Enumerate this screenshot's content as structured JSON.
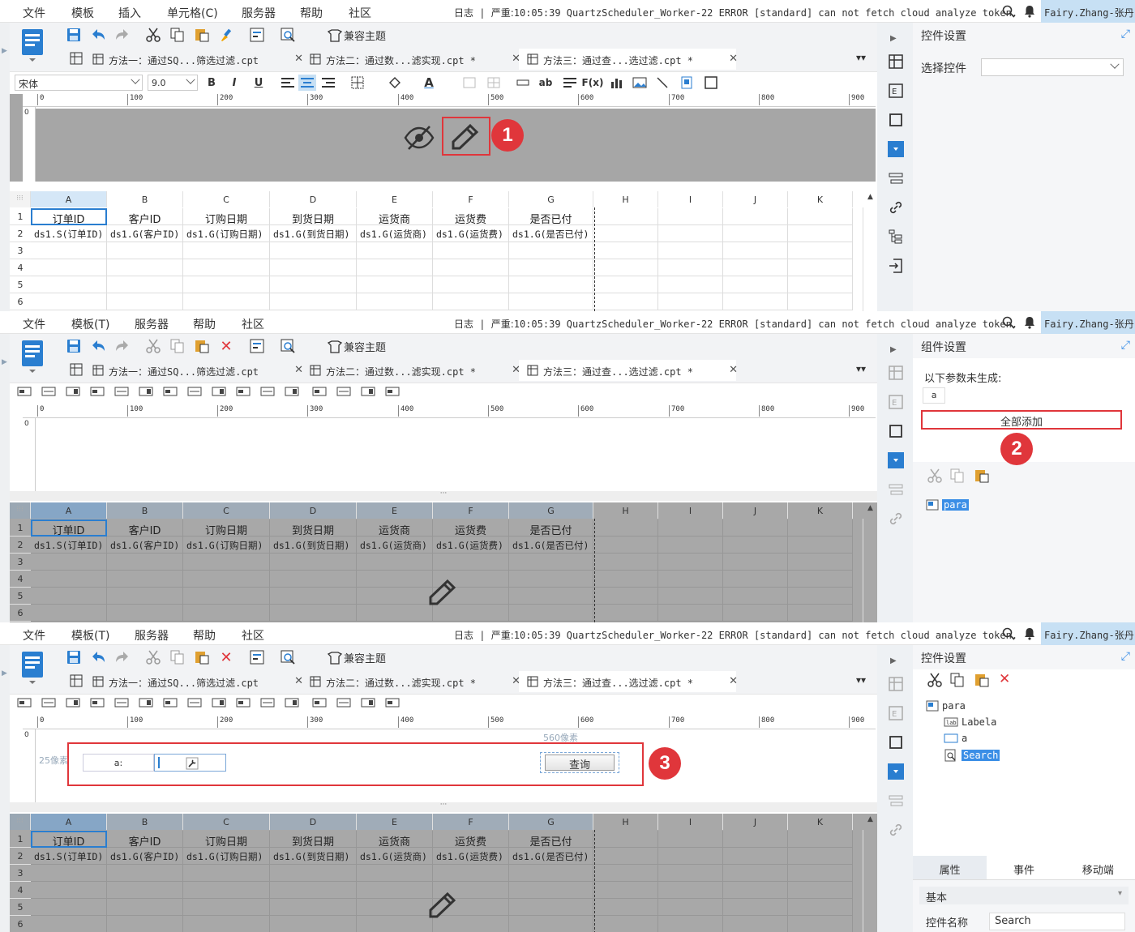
{
  "menus_p1": [
    "文件",
    "模板",
    "插入",
    "单元格(C)",
    "服务器",
    "帮助",
    "社区"
  ],
  "menus_p2": [
    "文件",
    "模板(T)",
    "服务器",
    "帮助",
    "社区"
  ],
  "log": {
    "label": "日志",
    "severity": "严重:",
    "message": "10:05:39 QuartzScheduler_Worker-22 ERROR [standard] can not fetch cloud analyze token."
  },
  "user": "Fairy.Zhang-张丹",
  "toolbar": {
    "compat_label": "兼容主题"
  },
  "tabs": [
    {
      "label": "方法一：通过SQ...筛选过滤.cpt"
    },
    {
      "label": "方法二：通过数...滤实现.cpt *"
    },
    {
      "label": "方法三：通过查...选过滤.cpt *"
    }
  ],
  "format": {
    "font": "宋体",
    "size": "9.0"
  },
  "ruler_ticks": [
    "0",
    "100",
    "200",
    "300",
    "400",
    "500",
    "600",
    "700",
    "800",
    "900"
  ],
  "sheet": {
    "columns": [
      "A",
      "B",
      "C",
      "D",
      "E",
      "F",
      "G",
      "H",
      "I",
      "J",
      "K"
    ],
    "rows": [
      "1",
      "2",
      "3",
      "4",
      "5",
      "6"
    ],
    "header_row": [
      "订单ID",
      "客户ID",
      "订购日期",
      "到货日期",
      "运货商",
      "运货费",
      "是否已付"
    ],
    "data_row": [
      "ds1.S(订单ID)",
      "ds1.G(客户ID)",
      "ds1.G(订购日期)",
      "ds1.G(到货日期)",
      "ds1.G(运货商)",
      "ds1.G(运货费)",
      "ds1.G(是否已付)"
    ]
  },
  "panel1_right": {
    "title": "控件设置",
    "select_label": "选择控件"
  },
  "panel2_right": {
    "title": "组件设置",
    "notice": "以下参数未生成:",
    "param": "a",
    "add_all": "全部添加",
    "tree_root": "para"
  },
  "panel3_right": {
    "title": "控件设置",
    "tree": [
      "para",
      "Labela",
      "a",
      "Search"
    ],
    "prop_tabs": [
      "属性",
      "事件",
      "移动端"
    ],
    "section": "基本",
    "name_label": "控件名称",
    "name_value": "Search"
  },
  "param_form": {
    "hint_h": "560像素",
    "hint_v": "25像素",
    "label_a": "a:",
    "query_button": "查询"
  },
  "badges": [
    "1",
    "2",
    "3"
  ],
  "colors": {
    "accent": "#3a8ee6",
    "annotation": "#e0363b"
  }
}
